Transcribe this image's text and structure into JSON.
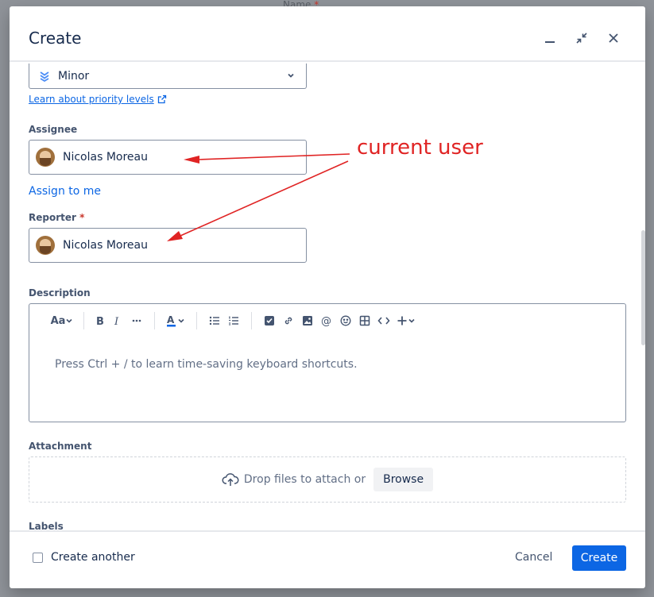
{
  "background": {
    "title": "Name",
    "required_mark": "*"
  },
  "dialog": {
    "title": "Create"
  },
  "priority": {
    "value": "Minor",
    "learn_link": "Learn about priority levels"
  },
  "assignee": {
    "label": "Assignee",
    "value": "Nicolas Moreau",
    "assign_to_me": "Assign to me"
  },
  "reporter": {
    "label": "Reporter",
    "required_mark": "*",
    "value": "Nicolas Moreau"
  },
  "description": {
    "label": "Description",
    "placeholder": "Press Ctrl + / to learn time-saving keyboard shortcuts.",
    "toolbar": {
      "text_style": "Aa"
    }
  },
  "attachment": {
    "label": "Attachment",
    "drop_text": "Drop files to attach or",
    "browse": "Browse"
  },
  "labels": {
    "label": "Labels"
  },
  "footer": {
    "create_another": "Create another",
    "cancel": "Cancel",
    "create": "Create"
  },
  "annotation": {
    "text": "current user",
    "color": "#e02424"
  },
  "colors": {
    "primary": "#0c66e4",
    "danger": "#c9372c",
    "text": "#172b4d"
  }
}
